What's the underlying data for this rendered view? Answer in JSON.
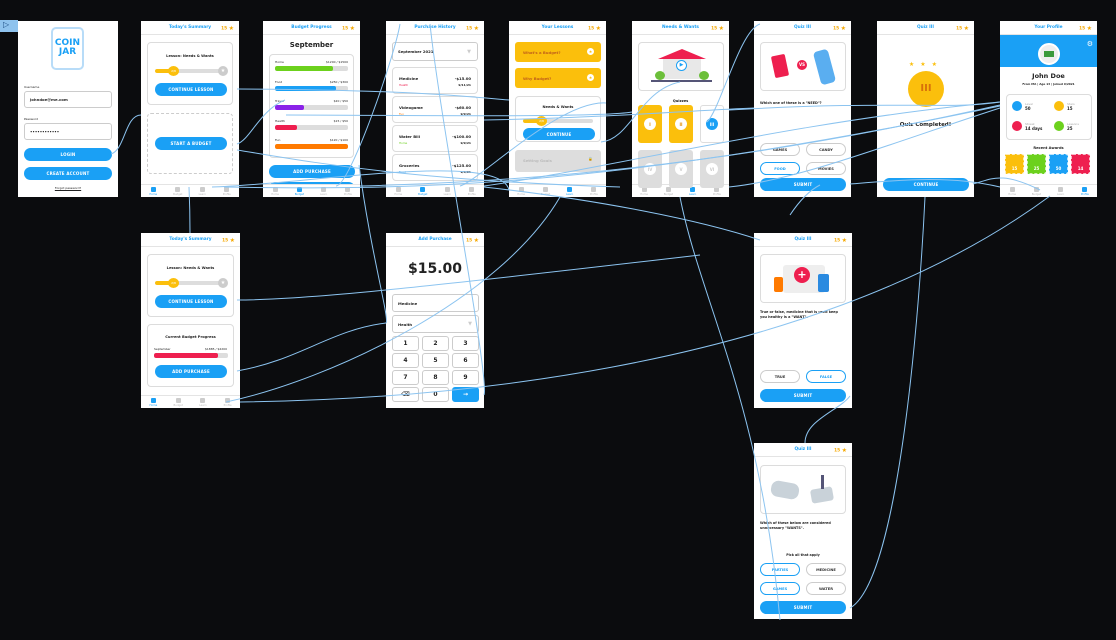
{
  "stars": "15",
  "star_icon": "star-icon",
  "tabs": [
    "Home",
    "Budget",
    "Learn",
    "Profile"
  ],
  "colors": {
    "accent": "#1aa0f5",
    "star": "#fbbf0c",
    "connector": "#8cc4f0"
  },
  "login": {
    "logo_line1": "COIN",
    "logo_line2": "JAR",
    "username_label": "Username",
    "username": "johndoe@me.com",
    "password_label": "Password",
    "password": "••••••••••••",
    "login": "LOGIN",
    "create": "CREATE ACCOUNT",
    "forgot": "Forgot password?"
  },
  "summary1": {
    "title": "Today's Summary",
    "lesson": "Lesson: Needs & Wants",
    "progress_label": "2/8",
    "progress": 0.25,
    "continue": "CONTINUE LESSON",
    "start": "START A BUDGET"
  },
  "budget": {
    "title": "Budget Progress",
    "month": "September",
    "items": [
      {
        "name": "Home",
        "amount": "$1200 / $1500",
        "pct": 0.8,
        "color": "#6cd11d"
      },
      {
        "name": "Food",
        "amount": "$250 / $300",
        "pct": 0.83,
        "color": "#1aa0f5"
      },
      {
        "name": "Travel",
        "amount": "$20 / $50",
        "pct": 0.4,
        "color": "#8a22e8"
      },
      {
        "name": "Health",
        "amount": "$15 / $50",
        "pct": 0.3,
        "color": "#ee1f4f"
      },
      {
        "name": "Fun",
        "amount": "$120 / $100",
        "pct": 1.0,
        "color": "#ff7a00"
      }
    ],
    "add": "ADD PURCHASE"
  },
  "history": {
    "title": "Purchase History",
    "month": "September 2021",
    "items": [
      {
        "name": "Medicine",
        "amount": "-$15.00",
        "cat": "Health",
        "date": "9/11/21",
        "color": "#ee1f4f"
      },
      {
        "name": "Videogame",
        "amount": "-$60.00",
        "cat": "Fun",
        "date": "9/9/21",
        "color": "#ff7a00"
      },
      {
        "name": "Water Bill",
        "amount": "-$100.00",
        "cat": "Home",
        "date": "9/9/21",
        "color": "#6cd11d"
      },
      {
        "name": "Groceries",
        "amount": "-$125.00",
        "cat": "Food",
        "date": "9/8/21",
        "color": "#1aa0f5"
      }
    ]
  },
  "lessons": {
    "title": "Your Lessons",
    "items": [
      "What's a Budget?",
      "Why Budget?"
    ],
    "current": "Needs & Wants",
    "progress_label": "2/8",
    "progress": 0.25,
    "continue": "CONTINUE",
    "locked": "Setting Goals"
  },
  "needs": {
    "title": "Needs & Wants",
    "quizzes_label": "Quizzes",
    "quizzes": [
      "I",
      "II",
      "III",
      "IV",
      "V",
      "VI"
    ]
  },
  "quiz1": {
    "title": "Quiz III",
    "question": "Which one of these is a \"NEED\"?",
    "vs": "VS",
    "options": [
      "GAMES",
      "CANDY",
      "FOOD",
      "MOVIES"
    ],
    "selected": "FOOD",
    "submit": "SUBMIT"
  },
  "quizdone": {
    "title": "Quiz III",
    "coin": "III",
    "message": "Quiz Completed!",
    "continue": "CONTINUE"
  },
  "profile": {
    "title": "Your Profile",
    "name": "John Doe",
    "sub": "From MA  |  Age 13  |  Joined 9/2021",
    "stats": [
      {
        "label": "Level",
        "value": "50",
        "color": "#1aa0f5"
      },
      {
        "label": "Stars",
        "value": "15",
        "color": "#fbbf0c"
      },
      {
        "label": "Streak",
        "value": "14 days",
        "color": "#ee1f4f"
      },
      {
        "label": "Lessons",
        "value": "25",
        "color": "#6cd11d"
      }
    ],
    "awards_label": "Recent Awards",
    "awards": [
      {
        "value": "15",
        "color": "#fbbf0c"
      },
      {
        "value": "25",
        "color": "#6cd11d"
      },
      {
        "value": "50",
        "color": "#1aa0f5"
      },
      {
        "value": "14",
        "color": "#ee1f4f"
      }
    ]
  },
  "summary2": {
    "title": "Today's Summary",
    "lesson": "Lesson: Needs & Wants",
    "progress_label": "2/8",
    "progress": 0.25,
    "continue": "CONTINUE LESSON",
    "budget_title": "Current Budget Progress",
    "budget_month": "September",
    "budget_amount": "$1885 / $2200",
    "budget_pct": 0.86,
    "add": "ADD PURCHASE"
  },
  "add": {
    "title": "Add Purchase",
    "amount": "$15.00",
    "name": "Medicine",
    "category": "Health",
    "keys": [
      "1",
      "2",
      "3",
      "4",
      "5",
      "6",
      "7",
      "8",
      "9",
      "⌫",
      "0",
      "→"
    ]
  },
  "quiz2": {
    "title": "Quiz III",
    "question": "True or false, medicine that is used keep you healthy is a \"WANT\".",
    "options": [
      "TRUE",
      "FALSE"
    ],
    "selected": "FALSE",
    "submit": "SUBMIT"
  },
  "quiz3": {
    "title": "Quiz III",
    "question": "Which of these below are considered unnecessary \"WANTS\".",
    "hint": "Pick all that apply",
    "options": [
      "PARTIES",
      "MEDICINE",
      "GAMES",
      "WATER"
    ],
    "selected": [
      "PARTIES",
      "GAMES"
    ],
    "submit": "SUBMIT"
  }
}
